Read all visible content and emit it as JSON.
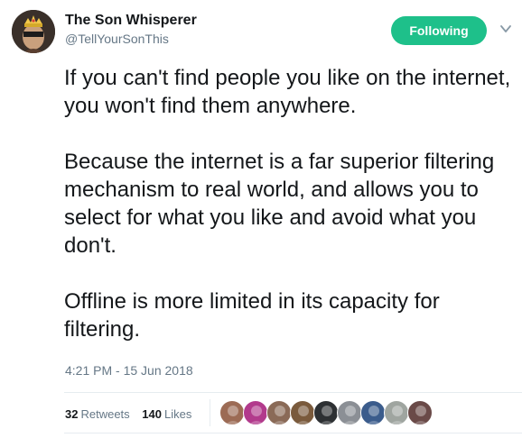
{
  "author": {
    "name": "The Son Whisperer",
    "handle": "@TellYourSonThis",
    "avatar_icon": "crowned-avatar-icon"
  },
  "follow_button": {
    "label": "Following",
    "color": "#1ec08a"
  },
  "tweet": {
    "paragraphs": [
      "If you can't find people you like on the internet, you won't find them anywhere.",
      "Because the internet is a far superior filtering mechanism to real world, and allows you to select for what you like and avoid what you don't.",
      "Offline is more limited in its capacity for filtering."
    ],
    "timestamp": "4:21 PM - 15 Jun 2018"
  },
  "stats": {
    "retweets_count": "32",
    "retweets_label": "Retweets",
    "likes_count": "140",
    "likes_label": "Likes"
  },
  "likers": [
    {
      "icon": "liker-avatar-1",
      "color": "#9c6b55"
    },
    {
      "icon": "liker-avatar-2",
      "color": "#b23a8c"
    },
    {
      "icon": "liker-avatar-3",
      "color": "#8a6a57"
    },
    {
      "icon": "liker-avatar-4",
      "color": "#7a5a3c"
    },
    {
      "icon": "liker-avatar-5",
      "color": "#2d3033"
    },
    {
      "icon": "liker-avatar-6",
      "color": "#8b8f95"
    },
    {
      "icon": "liker-avatar-7",
      "color": "#3b5c8c"
    },
    {
      "icon": "liker-avatar-8",
      "color": "#9fa5a0"
    },
    {
      "icon": "liker-avatar-9",
      "color": "#6a4a48"
    }
  ]
}
